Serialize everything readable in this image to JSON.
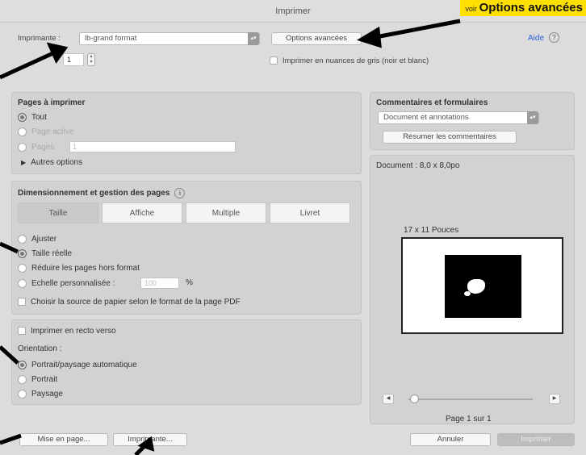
{
  "window": {
    "title": "Imprimer"
  },
  "callout": {
    "prefix": "voir",
    "text": "Options avancées"
  },
  "printer": {
    "label": "Imprimante :",
    "value": "lb-grand format",
    "advanced_button": "Options avancées",
    "help_link": "Aide",
    "copies_value": "1",
    "grayscale_label": "Imprimer en nuances de gris (noir et blanc)"
  },
  "pages": {
    "heading": "Pages à imprimer",
    "all": "Tout",
    "active": "Page active",
    "pages_label": "Pages",
    "pages_value": "1",
    "more": "Autres options"
  },
  "sizing": {
    "heading": "Dimensionnement et gestion des pages",
    "tabs": [
      "Taille",
      "Affiche",
      "Multiple",
      "Livret"
    ],
    "options": [
      "Ajuster",
      "Taille réelle",
      "Réduire les pages hors format",
      "Echelle personnalisée :"
    ],
    "scale_value": "100",
    "scale_unit": "%",
    "source_label": "Choisir la source de papier selon le format de la page PDF"
  },
  "duplex": {
    "label": "Imprimer en recto verso",
    "orientation_label": "Orientation :",
    "orientations": [
      "Portrait/paysage automatique",
      "Portrait",
      "Paysage"
    ]
  },
  "comments": {
    "heading": "Commentaires et formulaires",
    "value": "Document et annotations",
    "summarize_button": "Résumer les commentaires"
  },
  "preview": {
    "document_size": "Document : 8,0 x 8,0po",
    "sheet_size": "17 x 11 Pouces",
    "page_indicator": "Page 1 sur 1"
  },
  "footer": {
    "page_setup": "Mise en page...",
    "printer_button": "Imprimante...",
    "cancel": "Annuler",
    "print": "Imprimer"
  }
}
